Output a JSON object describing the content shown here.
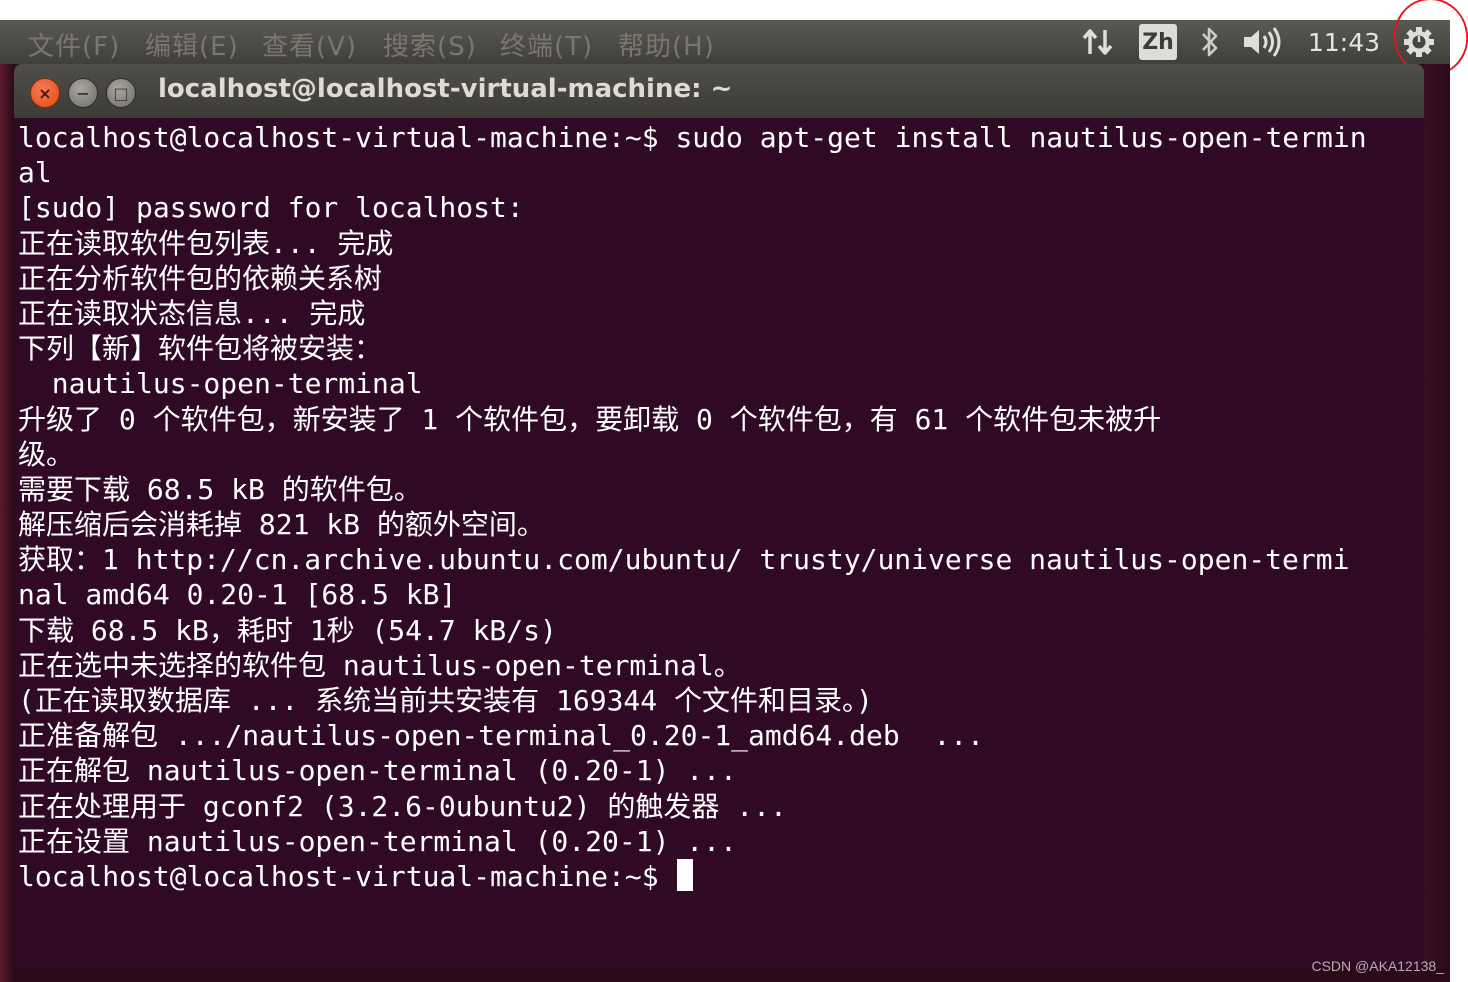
{
  "top_panel": {
    "menus": [
      "文件(F)",
      "编辑(E)",
      "查看(V)",
      "搜索(S)",
      "终端(T)",
      "帮助(H)"
    ],
    "input_method": "Zh",
    "clock": "11:43",
    "icons": [
      "network-transfer-icon",
      "bluetooth-icon",
      "volume-icon",
      "power-gear-icon"
    ]
  },
  "window": {
    "title": "localhost@localhost-virtual-machine: ~",
    "close_glyph": "×",
    "min_glyph": "−",
    "max_glyph": "□"
  },
  "terminal": {
    "lines": [
      "localhost@localhost-virtual-machine:~$ sudo apt-get install nautilus-open-termin",
      "al",
      "[sudo] password for localhost:",
      "正在读取软件包列表... 完成",
      "正在分析软件包的依赖关系树",
      "正在读取状态信息... 完成",
      "下列【新】软件包将被安装：",
      "  nautilus-open-terminal",
      "升级了 0 个软件包，新安装了 1 个软件包，要卸载 0 个软件包，有 61 个软件包未被升",
      "级。",
      "需要下载 68.5 kB 的软件包。",
      "解压缩后会消耗掉 821 kB 的额外空间。",
      "获取：1 http://cn.archive.ubuntu.com/ubuntu/ trusty/universe nautilus-open-termi",
      "nal amd64 0.20-1 [68.5 kB]",
      "下载 68.5 kB，耗时 1秒 (54.7 kB/s)",
      "正在选中未选择的软件包 nautilus-open-terminal。",
      "(正在读取数据库 ... 系统当前共安装有 169344 个文件和目录。)",
      "正准备解包 .../nautilus-open-terminal_0.20-1_amd64.deb  ...",
      "正在解包 nautilus-open-terminal (0.20-1) ...",
      "正在处理用于 gconf2 (3.2.6-0ubuntu2) 的触发器 ...",
      "正在设置 nautilus-open-terminal (0.20-1) ..."
    ],
    "prompt": "localhost@localhost-virtual-machine:~$ "
  },
  "watermark": "CSDN @AKA12138_",
  "colors": {
    "terminal_bg": "#300a24",
    "panel_bg": "#403f3a",
    "close_button": "#df4a16",
    "annotation_circle": "#e8141b"
  }
}
